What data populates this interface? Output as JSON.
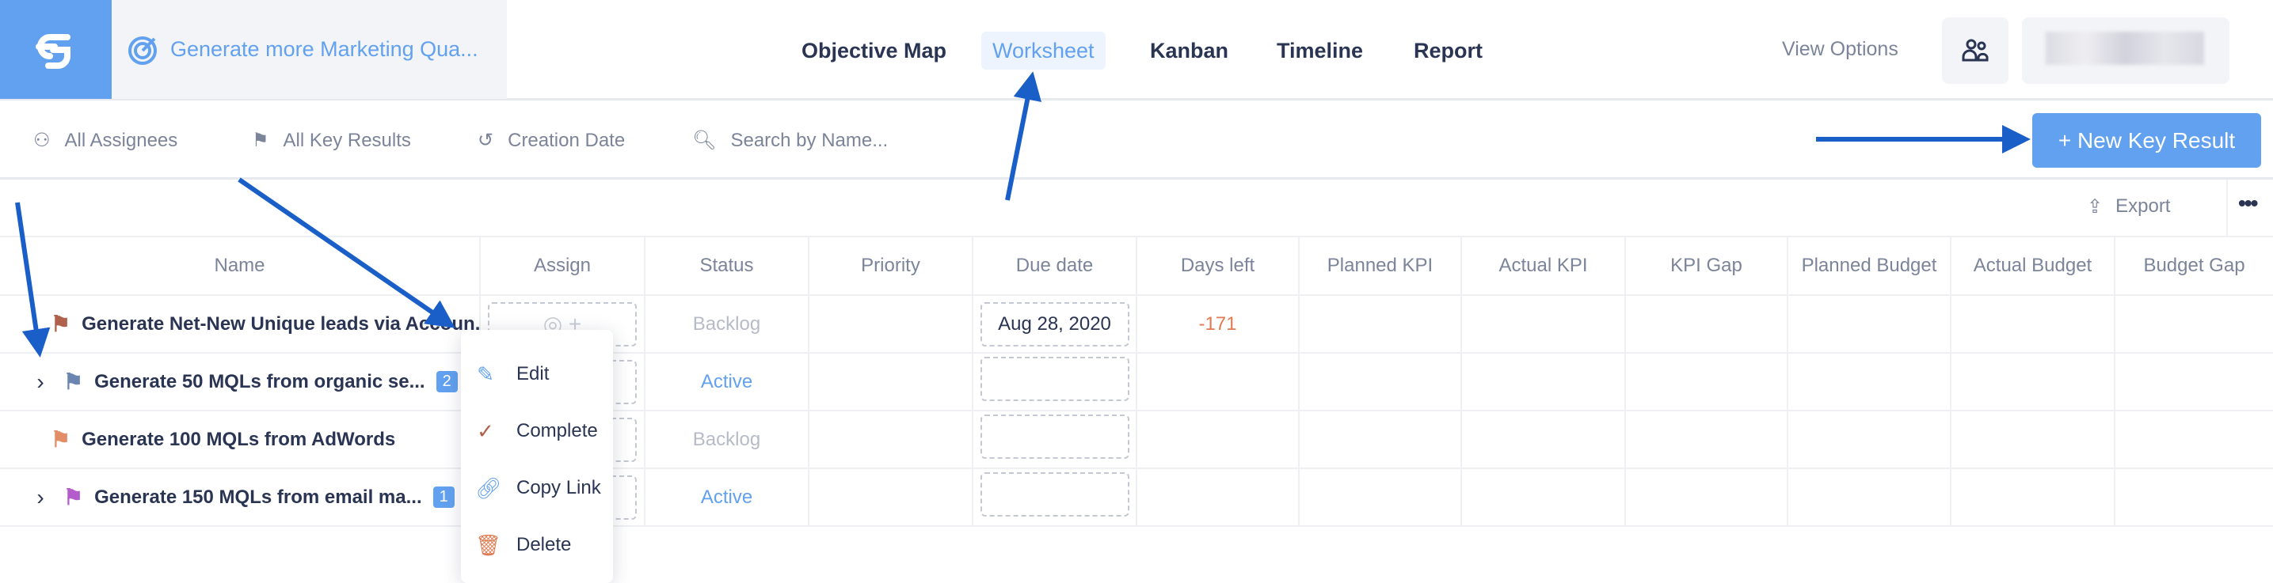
{
  "header": {
    "logo_icon": "goals-logo",
    "project_title": "Generate more Marketing Qua...",
    "nav": [
      {
        "label": "Objective Map",
        "active": false
      },
      {
        "label": "Worksheet",
        "active": true
      },
      {
        "label": "Kanban",
        "active": false
      },
      {
        "label": "Timeline",
        "active": false
      },
      {
        "label": "Report",
        "active": false
      }
    ],
    "view_options": "View Options",
    "people_icon": "users-icon"
  },
  "filters": {
    "assignees": "All Assignees",
    "key_results": "All Key Results",
    "creation_date": "Creation Date",
    "search_placeholder": "Search by Name...",
    "new_button": "+ New Key Result"
  },
  "toolbar": {
    "export": "Export",
    "more": "•••"
  },
  "table": {
    "columns": [
      "Name",
      "Assign",
      "Status",
      "Priority",
      "Due date",
      "Days left",
      "Planned KPI",
      "Actual KPI",
      "KPI Gap",
      "Planned Budget",
      "Actual Budget",
      "Budget Gap"
    ],
    "rows": [
      {
        "name": "Generate Net-New Unique leads via Accoun...",
        "flag_color": "#b0614c",
        "expandable": false,
        "badge": "",
        "status": "Backlog",
        "due": "Aug 28, 2020",
        "days_left": "-171"
      },
      {
        "name": "Generate 50 MQLs from organic se...",
        "flag_color": "#6a86b0",
        "expandable": true,
        "badge": "2",
        "status": "Active",
        "due": "",
        "days_left": ""
      },
      {
        "name": "Generate 100 MQLs from AdWords",
        "flag_color": "#e38d66",
        "expandable": false,
        "badge": "",
        "status": "Backlog",
        "due": "",
        "days_left": ""
      },
      {
        "name": "Generate 150 MQLs from email ma...",
        "flag_color": "#b45ccc",
        "expandable": true,
        "badge": "1",
        "status": "Active",
        "due": "",
        "days_left": ""
      }
    ]
  },
  "context_menu": [
    {
      "label": "Edit",
      "icon": "pencil-icon",
      "color": "#62a1ef"
    },
    {
      "label": "Complete",
      "icon": "check-icon",
      "color": "#b0614c"
    },
    {
      "label": "Copy Link",
      "icon": "link-icon",
      "color": "#62a1ef"
    },
    {
      "label": "Delete",
      "icon": "trash-icon",
      "color": "#e07a52"
    }
  ],
  "colors": {
    "accent": "#62a1ef",
    "text": "#2a3453",
    "muted": "#7c849a",
    "overdue": "#e07a52"
  }
}
